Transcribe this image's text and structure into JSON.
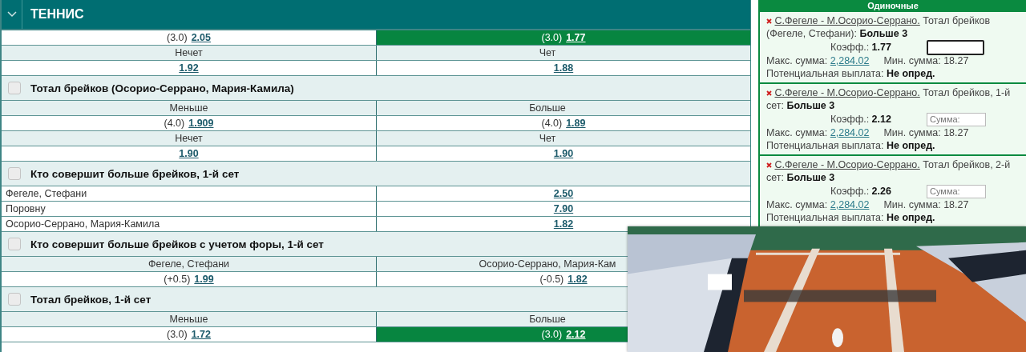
{
  "sport_header": {
    "title": "ТЕННИС",
    "expanded": true
  },
  "markets": [
    {
      "rows": [
        {
          "kind": "odds",
          "cells": [
            {
              "handicap": "(3.0)",
              "odds": "2.05",
              "selected": false
            },
            {
              "handicap": "(3.0)",
              "odds": "1.77",
              "selected": true
            }
          ]
        },
        {
          "kind": "labels",
          "cells": [
            "Нечет",
            "Чет"
          ]
        },
        {
          "kind": "odds",
          "cells": [
            {
              "odds": "1.92",
              "selected": false
            },
            {
              "odds": "1.88",
              "selected": false
            }
          ]
        }
      ]
    },
    {
      "title": "Тотал брейков (Осорио-Серрано, Мария-Камила)",
      "checked": false,
      "rows": [
        {
          "kind": "labels",
          "cells": [
            "Меньше",
            "Больше"
          ]
        },
        {
          "kind": "odds",
          "cells": [
            {
              "handicap": "(4.0)",
              "odds": "1.909",
              "selected": false
            },
            {
              "handicap": "(4.0)",
              "odds": "1.89",
              "selected": false
            }
          ]
        },
        {
          "kind": "labels",
          "cells": [
            "Нечет",
            "Чет"
          ]
        },
        {
          "kind": "odds",
          "cells": [
            {
              "odds": "1.90",
              "selected": false
            },
            {
              "odds": "1.90",
              "selected": false
            }
          ]
        }
      ]
    },
    {
      "title": "Кто совершит больше брейков, 1-й сет",
      "checked": false,
      "rows": [
        {
          "kind": "outcome",
          "name": "Фегеле, Стефани",
          "odds": "2.50"
        },
        {
          "kind": "outcome",
          "name": "Поровну",
          "odds": "7.90"
        },
        {
          "kind": "outcome",
          "name": "Осорио-Серрано, Мария-Камила",
          "odds": "1.82"
        }
      ]
    },
    {
      "title": "Кто совершит больше брейков с учетом форы, 1-й сет",
      "checked": false,
      "rows": [
        {
          "kind": "labels",
          "cells": [
            "Фегеле, Стефани",
            "Осорио-Серрано, Мария-Кам"
          ]
        },
        {
          "kind": "odds",
          "cells": [
            {
              "handicap": "(+0.5)",
              "odds": "1.99",
              "selected": false
            },
            {
              "handicap": "(-0.5)",
              "odds": "1.82",
              "selected": false
            }
          ]
        }
      ]
    },
    {
      "title": "Тотал брейков, 1-й сет",
      "checked": false,
      "rows": [
        {
          "kind": "labels",
          "cells": [
            "Меньше",
            "Больше"
          ]
        },
        {
          "kind": "odds",
          "cells": [
            {
              "handicap": "(3.0)",
              "odds": "1.72",
              "selected": false
            },
            {
              "handicap": "(3.0)",
              "odds": "2.12",
              "selected": true
            }
          ]
        }
      ]
    }
  ],
  "bet_slip": {
    "title": "Одиночные",
    "bets": [
      {
        "event": "С.Фегеле - М.Осорио-Серрано.",
        "market": "Тотал брейков (Фегеле, Стефани):",
        "pick": "Больше 3",
        "coef_label": "Коэфф.:",
        "coef": "1.77",
        "focused": true,
        "max_label": "Макс. сумма:",
        "max": "2,284.02",
        "min_label": "Мин. сумма:",
        "min": "18.27",
        "payout_label": "Потенциальная выплата:",
        "payout": "Не опред."
      },
      {
        "event": "С.Фегеле - М.Осорио-Серрано.",
        "market": "Тотал брейков, 1-й сет:",
        "pick": "Больше 3",
        "coef_label": "Коэфф.:",
        "coef": "2.12",
        "stake_placeholder": "Сумма:",
        "focused": false,
        "max_label": "Макс. сумма:",
        "max": "2,284.02",
        "min_label": "Мин. сумма:",
        "min": "18.27",
        "payout_label": "Потенциальная выплата:",
        "payout": "Не опред."
      },
      {
        "event": "С.Фегеле - М.Осорио-Серрано.",
        "market": "Тотал брейков, 2-й сет:",
        "pick": "Больше 3",
        "coef_label": "Коэфф.:",
        "coef": "2.26",
        "stake_placeholder": "Сумма:",
        "focused": false,
        "max_label": "Макс. сумма:",
        "max": "2,284.02",
        "min_label": "Мин. сумма:",
        "min": "18.27",
        "payout_label": "Потенциальная выплата:",
        "payout": "Не опред."
      }
    ]
  }
}
